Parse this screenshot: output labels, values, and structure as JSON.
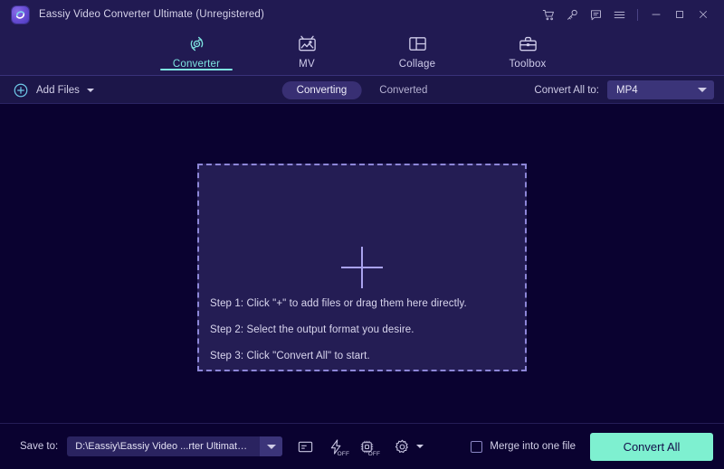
{
  "window": {
    "title": "Eassiy Video Converter Ultimate (Unregistered)",
    "logo_icon": "eassiy-logo",
    "controls": [
      {
        "name": "cart-icon",
        "label": ""
      },
      {
        "name": "key-icon",
        "label": ""
      },
      {
        "name": "feedback-icon",
        "label": ""
      },
      {
        "name": "menu-icon",
        "label": ""
      },
      {
        "name": "minimize-icon",
        "label": ""
      },
      {
        "name": "maximize-icon",
        "label": ""
      },
      {
        "name": "close-icon",
        "label": ""
      }
    ]
  },
  "nav": {
    "tabs": [
      {
        "label": "Converter",
        "icon": "converter-icon",
        "active": true
      },
      {
        "label": "MV",
        "icon": "mv-icon",
        "active": false
      },
      {
        "label": "Collage",
        "icon": "collage-icon",
        "active": false
      },
      {
        "label": "Toolbox",
        "icon": "toolbox-icon",
        "active": false
      }
    ],
    "accent": "#7de3e0"
  },
  "toolbar": {
    "add_files_label": "Add Files",
    "segments": [
      {
        "label": "Converting",
        "active": true
      },
      {
        "label": "Converted",
        "active": false
      }
    ],
    "convert_all_to_label": "Convert All to:",
    "format_value": "MP4"
  },
  "dropzone": {
    "plus_icon": "plus-icon",
    "steps": [
      "Step 1: Click \"+\" to add files or drag them here directly.",
      "Step 2: Select the output format you desire.",
      "Step 3: Click \"Convert All\" to start."
    ],
    "border_color": "#8d86d8",
    "fill_color": "#241d54"
  },
  "footer": {
    "save_to_label": "Save to:",
    "save_path": "D:\\Eassiy\\Eassiy Video ...rter Ultimate\\Converted",
    "tools": [
      {
        "name": "open-folder-icon",
        "badge": ""
      },
      {
        "name": "fast-conversion-icon",
        "badge": "OFF"
      },
      {
        "name": "gpu-acceleration-icon",
        "badge": "OFF"
      },
      {
        "name": "settings-gear-icon",
        "badge": ""
      }
    ],
    "merge_label": "Merge into one file",
    "merge_checked": false,
    "convert_all_label": "Convert All",
    "convert_all_color": "#7ef0d0"
  }
}
